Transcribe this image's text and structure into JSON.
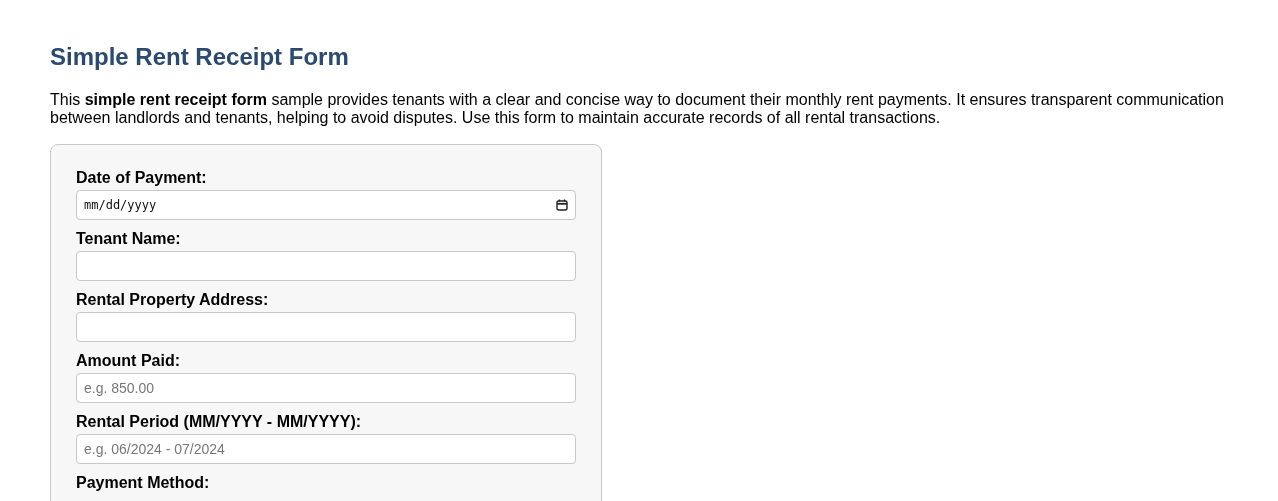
{
  "title": "Simple Rent Receipt Form",
  "intro": "This **simple rent receipt form** sample provides tenants with a clear and concise way to document their monthly rent payments. It ensures transparent communication between landlords and tenants, helping to avoid disputes. Use this form to maintain accurate records of all rental transactions.",
  "fields": [
    {
      "kind": "date",
      "label": "Date of Payment:",
      "placeholder": "mm/dd/yyyy"
    },
    {
      "kind": "text",
      "label": "Tenant Name:"
    },
    {
      "kind": "text",
      "label": "Rental Property Address:"
    },
    {
      "kind": "text",
      "label": "Amount Paid:",
      "placeholder": "e.g. 850.00"
    },
    {
      "kind": "text",
      "label": "Rental Period (MM/YYYY - MM/YYYY):",
      "placeholder": "e.g. 06/2024 - 07/2024"
    },
    {
      "kind": "label",
      "label": "Payment Method:"
    }
  ]
}
